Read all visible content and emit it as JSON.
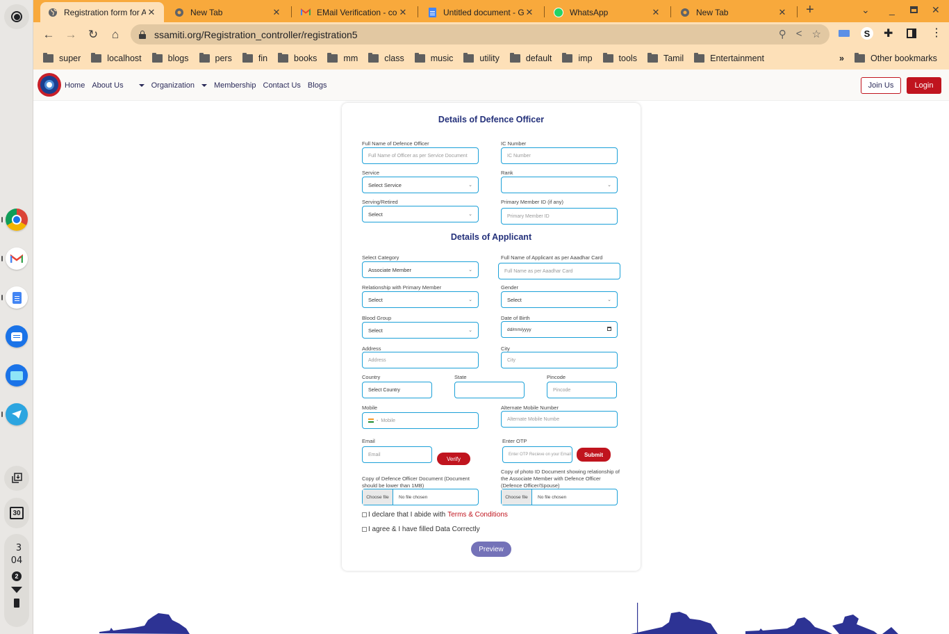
{
  "shelf": {
    "apps": [
      {
        "name": "chrome-app",
        "label": "Chrome"
      },
      {
        "name": "gmail-app",
        "label": "Gmail"
      },
      {
        "name": "docs-app",
        "label": "Docs"
      },
      {
        "name": "messages-app",
        "label": "Messages"
      },
      {
        "name": "files-app",
        "label": "Files"
      },
      {
        "name": "telegram-app",
        "label": "Telegram"
      }
    ],
    "calendar_day": "30",
    "clock_hour": "3",
    "clock_minute": "04",
    "notification_count": "2"
  },
  "browser": {
    "tabs": [
      {
        "label": "Registration form for A",
        "icon": "globe-icon",
        "active": true
      },
      {
        "label": "New Tab",
        "icon": "chrome-icon",
        "active": false
      },
      {
        "label": "EMail Verification - co",
        "icon": "gmail-icon",
        "active": false
      },
      {
        "label": "Untitled document - G",
        "icon": "docs-icon",
        "active": false
      },
      {
        "label": "WhatsApp",
        "icon": "whatsapp-icon",
        "active": false
      },
      {
        "label": "New Tab",
        "icon": "chrome-icon",
        "active": false
      }
    ],
    "url": "ssamiti.org/Registration_controller/registration5",
    "bookmarks": [
      "super",
      "localhost",
      "blogs",
      "pers",
      "fin",
      "books",
      "mm",
      "class",
      "music",
      "utility",
      "default",
      "imp",
      "tools",
      "Tamil",
      "Entertainment"
    ],
    "other_bookmarks": "Other bookmarks",
    "more_bookmarks": "»"
  },
  "site": {
    "nav": {
      "home": "Home",
      "about": "About Us",
      "organization": "Organization",
      "membership": "Membership",
      "contact": "Contact Us",
      "blogs": "Blogs",
      "join": "Join Us",
      "login": "Login"
    },
    "officer_section": {
      "title": "Details of Defence Officer",
      "full_name": {
        "label": "Full Name of Defence Officer",
        "placeholder": "Full Name of Officer as per Service Document"
      },
      "ic_number": {
        "label": "IC Number",
        "placeholder": "IC Number"
      },
      "service": {
        "label": "Service",
        "value": "Select Service"
      },
      "rank": {
        "label": "Rank",
        "value": ""
      },
      "serving_retired": {
        "label": "Serving/Retired",
        "value": "Select"
      },
      "primary_member_id": {
        "label": "Primary Member ID (if any)",
        "placeholder": "Primary Member ID"
      }
    },
    "applicant_section": {
      "title": "Details of Applicant",
      "category": {
        "label": "Select Category",
        "value": "Associate Member"
      },
      "applicant_name": {
        "label": "Full Name of Applicant as per Aaadhar Card",
        "placeholder": "Full Name  as per Aaadhar Card"
      },
      "relationship": {
        "label": "Relationship with Primary Member",
        "value": "Select"
      },
      "gender": {
        "label": "Gender",
        "value": "Select"
      },
      "blood_group": {
        "label": "Blood Group",
        "value": "Select"
      },
      "dob": {
        "label": "Date of Birth",
        "placeholder": "dd/mm/yyyy"
      },
      "address": {
        "label": "Address",
        "placeholder": "Address"
      },
      "city": {
        "label": "City",
        "placeholder": "City"
      },
      "country": {
        "label": "Country",
        "value": "Select Country"
      },
      "state": {
        "label": "State",
        "value": ""
      },
      "pincode": {
        "label": "Pincode",
        "placeholder": "Pincode"
      },
      "mobile": {
        "label": "Mobile",
        "prefix": "-",
        "placeholder": "Mobile"
      },
      "alt_mobile": {
        "label": "Alternate Mobile Number",
        "placeholder": "Alternate Mobile Numbe"
      },
      "email": {
        "label": "Email",
        "placeholder": "Email",
        "verify_label": "Verify"
      },
      "otp": {
        "label": "Enter OTP",
        "placeholder": "Enter OTP Recieve on your Email",
        "submit_label": "Submit"
      },
      "officer_doc": {
        "label": "Copy of Defence Officer Document (Document should be lower than 1MB)",
        "choose": "Choose file",
        "status": "No file chosen"
      },
      "photo_id_doc": {
        "label": "Copy of photo ID Document showing relationship of the Associate Member with Defence Officer (Defence Officer/Spouse)",
        "choose": "Choose file",
        "status": "No file chosen"
      },
      "declare_text": "I declare that I abide with",
      "terms_link": "Terms & Conditions",
      "agree_text": "I agree & I have filled Data Correctly",
      "preview_label": "Preview"
    },
    "colors": {
      "brand_red": "#c0141e",
      "title_navy": "#23307a",
      "field_border": "#1ba0d8",
      "preview_purple": "#7472b8",
      "silhouette": "#2d3394"
    }
  }
}
